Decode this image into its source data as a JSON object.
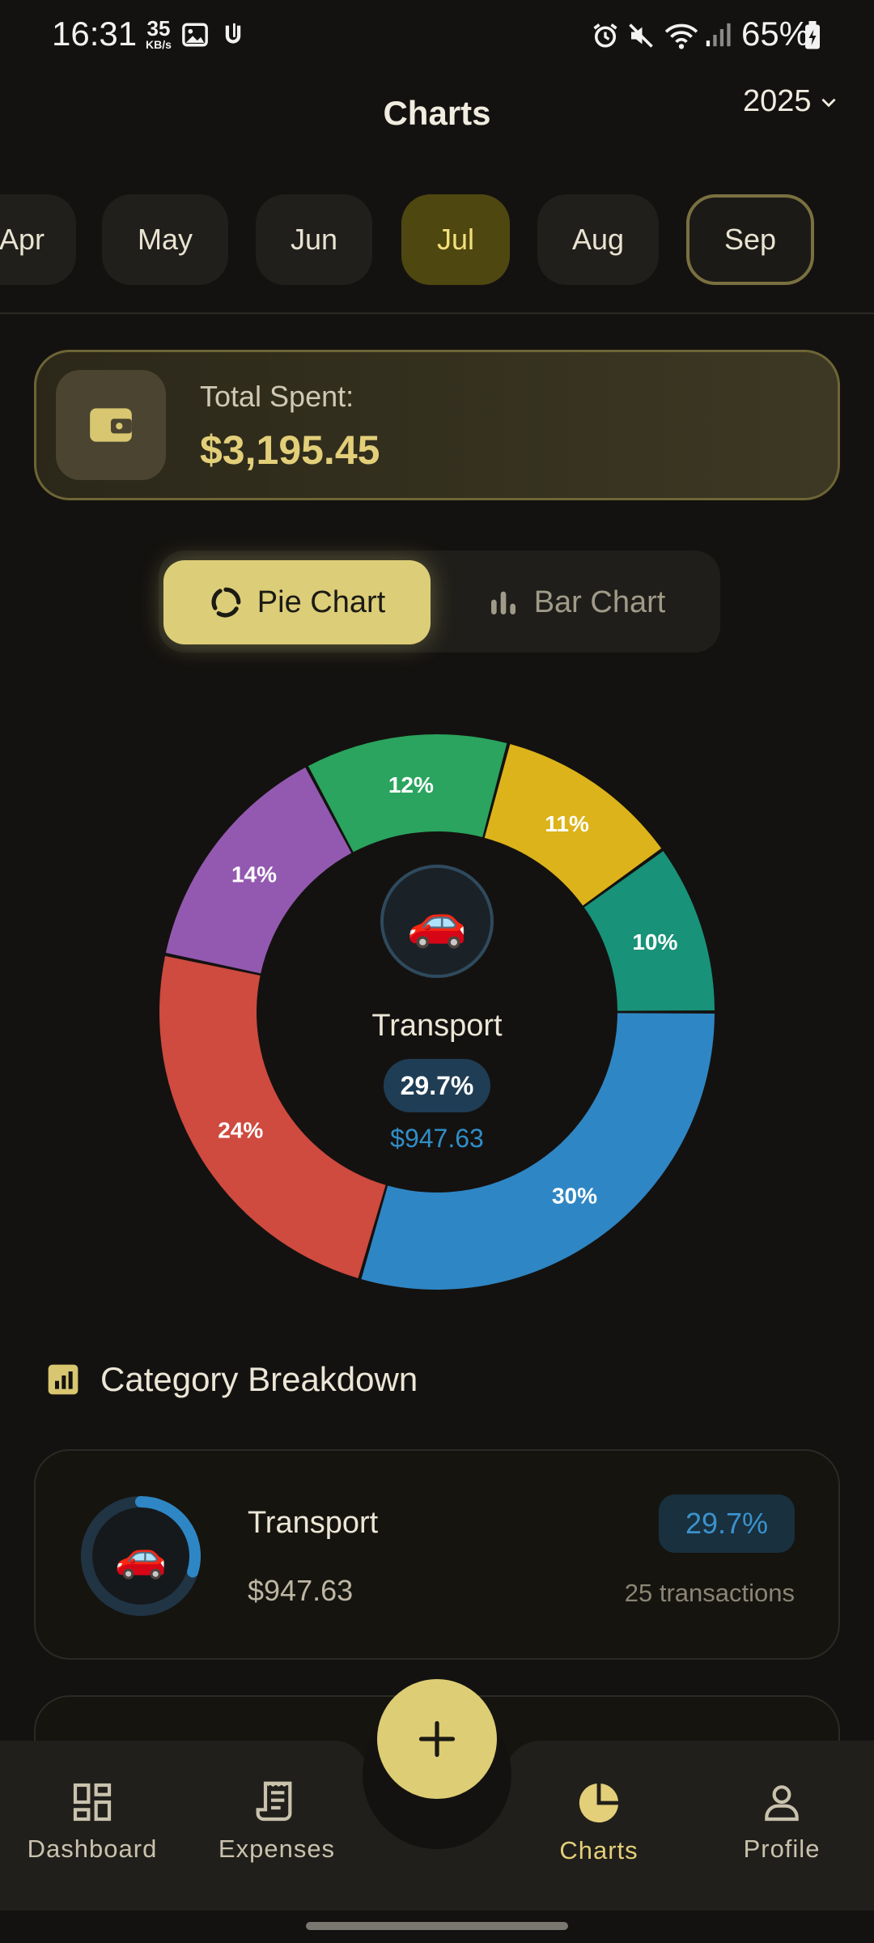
{
  "status_bar": {
    "time": "16:31",
    "net_speed": "35",
    "net_unit": "KB/s",
    "battery": "65%"
  },
  "header": {
    "title": "Charts",
    "year": "2025"
  },
  "months": [
    {
      "label": "Apr"
    },
    {
      "label": "May"
    },
    {
      "label": "Jun"
    },
    {
      "label": "Jul",
      "state": "selected"
    },
    {
      "label": "Aug"
    },
    {
      "label": "Sep",
      "state": "current"
    }
  ],
  "total": {
    "label": "Total Spent:",
    "value": "$3,195.45"
  },
  "toggle": {
    "pie_label": "Pie Chart",
    "bar_label": "Bar Chart",
    "selected": "pie"
  },
  "chart_data": {
    "type": "pie",
    "style": "donut",
    "slice_labels": [
      "30%",
      "24%",
      "14%",
      "12%",
      "11%",
      "10%"
    ],
    "values": [
      29.7,
      24,
      14,
      12,
      11,
      10
    ],
    "colors": [
      "#2f86c4",
      "#cf4a3f",
      "#9359b0",
      "#2aa45e",
      "#dcb31a",
      "#189279"
    ],
    "selected_slice": {
      "icon": "car-emoji",
      "emoji": "🚗",
      "name": "Transport",
      "percent": "29.7%",
      "amount": "$947.63"
    }
  },
  "breakdown": {
    "title": "Category Breakdown",
    "items": [
      {
        "name": "Transport",
        "emoji": "🚗",
        "amount": "$947.63",
        "percent": "29.7%",
        "transactions": "25 transactions",
        "fraction": 0.297,
        "color": "#2f86c4"
      }
    ]
  },
  "nav": {
    "dashboard": "Dashboard",
    "expenses": "Expenses",
    "charts": "Charts",
    "profile": "Profile",
    "active": "charts"
  },
  "colors": {
    "background": "#141210",
    "accent": "#ddcd74",
    "selected_month": "#4f4710"
  }
}
